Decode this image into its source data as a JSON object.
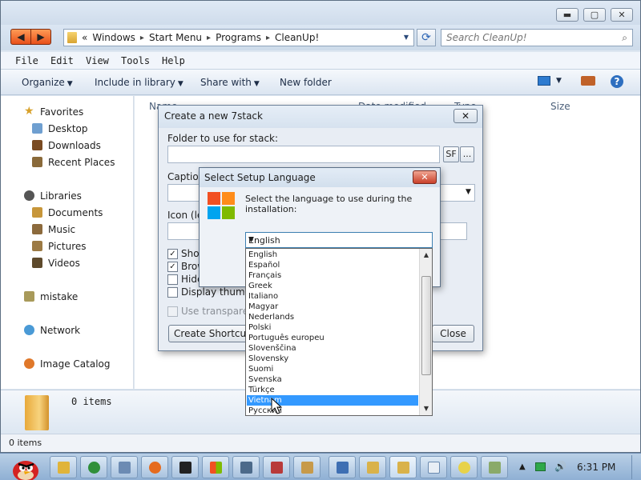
{
  "window": {
    "caption_min": "▬",
    "caption_max": "▢",
    "caption_close": "✕"
  },
  "address": {
    "back": "◀",
    "forward": "▶",
    "overflow": "«",
    "crumbs": [
      "Windows",
      "Start Menu",
      "Programs",
      "CleanUp!"
    ],
    "separator": "▸",
    "dropdown": "▼",
    "search_placeholder": "Search CleanUp!"
  },
  "menu": [
    "File",
    "Edit",
    "View",
    "Tools",
    "Help"
  ],
  "commands": {
    "organize": "Organize",
    "include": "Include in library",
    "share": "Share with",
    "new_folder": "New folder",
    "help": "?"
  },
  "navpane": {
    "favorites": "Favorites",
    "desktop": "Desktop",
    "downloads": "Downloads",
    "recent": "Recent Places",
    "libraries": "Libraries",
    "documents": "Documents",
    "music": "Music",
    "pictures": "Pictures",
    "videos": "Videos",
    "mistake": "mistake",
    "network": "Network",
    "image_catalog": "Image Catalog"
  },
  "columns": {
    "name": "Name",
    "date": "Date modified",
    "type": "Type",
    "size": "Size"
  },
  "details": {
    "count": "0 items"
  },
  "status": {
    "text": "0 items"
  },
  "stack_dialog": {
    "title": "Create a new 7stack",
    "close": "✕",
    "folder_label": "Folder to use for stack:",
    "sf_button": "SF",
    "browse_button": "...",
    "caption_label": "Caption",
    "icon_label": "Icon (le",
    "chk_show": "Show",
    "chk_browse": "Brow",
    "chk_hide": "Hide",
    "chk_thumbs": "Display thumbn",
    "chk_transparent": "Use transparent",
    "shortcut_button": "Create Shortcut o",
    "close_button": "Close",
    "checked_mark": "✓"
  },
  "lang_dialog": {
    "title": "Select Setup Language",
    "close": "✕",
    "prompt_line1": "Select the language to use during the",
    "prompt_line2": "installation:",
    "selected": "English",
    "arrow": "▼",
    "options": [
      "English",
      "Español",
      "Français",
      "Greek",
      "Italiano",
      "Magyar",
      "Nederlands",
      "Polski",
      "Português europeu",
      "Slovenščina",
      "Slovensky",
      "Suomi",
      "Svenska",
      "Türkçe",
      "Vietnam",
      "Русский"
    ],
    "highlighted": "Vietnam",
    "scroll_up": "▲",
    "scroll_down": "▼",
    "logo_colors": [
      "#f25022",
      "#ff8c1a",
      "#00a4ef",
      "#7fba00"
    ]
  },
  "taskbar": {
    "clock": "6:31 PM",
    "tray_arrow": "▲",
    "volume": "🔊"
  }
}
